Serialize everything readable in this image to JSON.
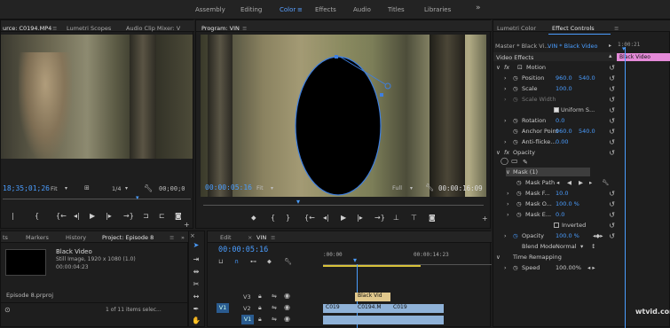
{
  "workspaces": [
    "Assembly",
    "Editing",
    "Color",
    "Effects",
    "Audio",
    "Titles",
    "Libraries"
  ],
  "active_workspace": "Color",
  "source_panel": {
    "tabs": [
      "urce: C0194.MP4",
      "Lumetri Scopes",
      "Audio Clip Mixer: V"
    ],
    "timecode": "18;35;01;26",
    "fit": "Fit",
    "ratio": "1/4",
    "end_timecode": "00;00;0"
  },
  "program_panel": {
    "title": "Program: VIN",
    "timecode": "00:00:05:16",
    "fit": "Fit",
    "quality": "Full",
    "duration": "00:00:16:09"
  },
  "effect_controls": {
    "tabs": [
      "Lumetri Color",
      "Effect Controls"
    ],
    "master": "Master * Black Vi...",
    "sequence": "VIN * Black Video",
    "time_label": "1:00:21",
    "clip_bar_label": "Black Video",
    "section": "Video Effects",
    "rows": {
      "motion": "Motion",
      "position_label": "Position",
      "position_x": "960.0",
      "position_y": "540.0",
      "scale_label": "Scale",
      "scale_value": "100.0",
      "scale_width_label": "Scale Width",
      "uniform_label": "Uniform S...",
      "rotation_label": "Rotation",
      "rotation_value": "0.0",
      "anchor_label": "Anchor Point",
      "anchor_x": "960.0",
      "anchor_y": "540.0",
      "antiflicker_label": "Anti-flicke...",
      "antiflicker_value": "0.00",
      "opacity_label": "Opacity",
      "mask_label": "Mask (1)",
      "mask_path_label": "Mask Path",
      "mask_feather_label": "Mask F...",
      "mask_feather_value": "10.0",
      "mask_opacity_label": "Mask O...",
      "mask_opacity_value": "100.0 %",
      "mask_expansion_label": "Mask E...",
      "mask_expansion_value": "0.0",
      "inverted_label": "Inverted",
      "opacity2_label": "Opacity",
      "opacity2_value": "100.0 %",
      "blend_label": "Blend Mode",
      "blend_value": "Normal",
      "time_remap_label": "Time Remapping",
      "speed_label": "Speed",
      "speed_value": "100.00%"
    }
  },
  "project_panel": {
    "tabs": [
      "ts",
      "Markers",
      "History",
      "Project: Episode 8"
    ],
    "item_name": "Black Video",
    "item_type": "Still Image, 1920 x 1080 (1.0)",
    "item_duration": "00:00:04:23",
    "project_file": "Episode 8.prproj",
    "selection_info": "1 of 11 items selec..."
  },
  "timeline": {
    "tabs": [
      "Edit",
      "VIN"
    ],
    "timecode": "00:00:05:16",
    "ruler_start": ":00:00",
    "ruler_end": "00:00:14:23",
    "tracks": [
      "V3",
      "V2",
      "V1"
    ],
    "source_patch": "V1",
    "clips": {
      "v3": "Black Vid",
      "v2a": "C019",
      "v2b": "C0194.M",
      "v2c": "C019"
    }
  },
  "watermark": "wtvid.com",
  "colors": {
    "accent": "#4a9dff",
    "clip_blue": "#8fb2d8",
    "clip_pink": "#e48ad8",
    "clip_gold": "#e2c98d",
    "playhead": "#4a9dff"
  }
}
